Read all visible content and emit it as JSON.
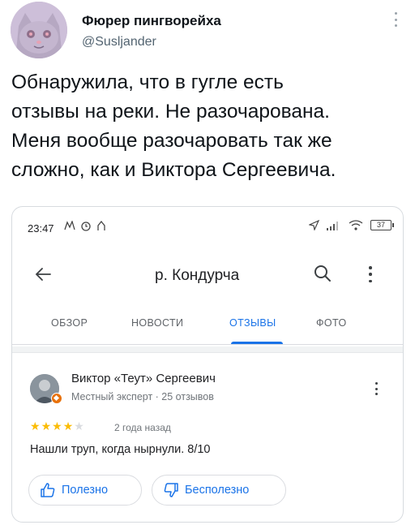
{
  "tweet": {
    "author_name": "Фюрер пингворейха",
    "author_handle": "@Susljander",
    "text": "Обнаружила, что в гугле есть\nотзывы на реки. Не разочарована.\nМеня вообще разочаровать так же\nсложно, как и Виктора Сергеевича."
  },
  "screenshot": {
    "status_bar": {
      "time": "23:47",
      "battery": "37",
      "left_icons": [
        "notification-icon",
        "alarm-icon",
        "cloud-icon"
      ],
      "right_icons": [
        "location-arrow-icon",
        "signal-icon",
        "wifi-icon",
        "battery-icon"
      ]
    },
    "topbar": {
      "title": "р. Кондурча"
    },
    "tabs": [
      {
        "label": "ОБЗОР",
        "active": false
      },
      {
        "label": "НОВОСТИ",
        "active": false
      },
      {
        "label": "ОТЗЫВЫ",
        "active": true
      },
      {
        "label": "ФОТО",
        "active": false
      }
    ],
    "review": {
      "reviewer_name": "Виктор «Теут» Сергеевич",
      "reviewer_meta": "Местный эксперт · 25 отзывов",
      "rating": 4,
      "max_rating": 5,
      "date": "2 года назад",
      "text": "Нашли труп, когда нырнули. 8/10",
      "helpful_label": "Полезно",
      "unhelpful_label": "Бесполезно"
    },
    "colors": {
      "accent": "#1a73e8",
      "star": "#fbbc04",
      "guide_badge": "#e8710a"
    }
  }
}
